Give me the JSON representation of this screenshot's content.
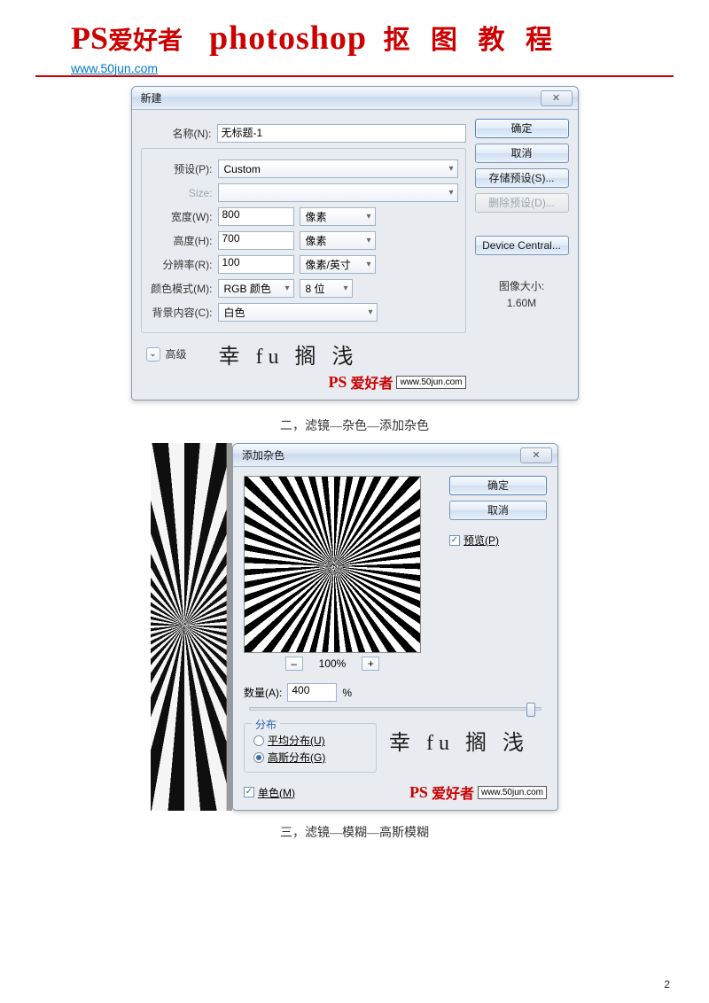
{
  "header": {
    "logo_ps": "PS",
    "logo_ah": "爱好者",
    "title_en": "photoshop",
    "title_cn": "抠 图 教 程",
    "url": "www.50jun.com"
  },
  "caption_noise": "二，滤镜—杂色—添加杂色",
  "caption_blur": "三，滤镜—模糊—高斯模糊",
  "page_number": "2",
  "dlg_new": {
    "title": "新建",
    "name_label": "名称(N):",
    "name_value": "无标题-1",
    "preset_label": "预设(P):",
    "preset_value": "Custom",
    "size_label": "Size:",
    "width_label": "宽度(W):",
    "width_value": "800",
    "width_unit": "像素",
    "height_label": "高度(H):",
    "height_value": "700",
    "height_unit": "像素",
    "res_label": "分辨率(R):",
    "res_value": "100",
    "res_unit": "像素/英寸",
    "mode_label": "颜色模式(M):",
    "mode_value": "RGB 颜色",
    "mode_bits": "8 位",
    "bg_label": "背景内容(C):",
    "bg_value": "白色",
    "advanced": "高级",
    "btn_ok": "确定",
    "btn_cancel": "取消",
    "btn_save_preset": "存储预设(S)...",
    "btn_del_preset": "删除预设(D)...",
    "btn_device": "Device Central...",
    "img_size_label": "图像大小:",
    "img_size_value": "1.60M",
    "watermark": "幸 fu 搁 浅",
    "wm_url": "www.50jun.com"
  },
  "dlg_noise": {
    "title": "添加杂色",
    "btn_ok": "确定",
    "btn_cancel": "取消",
    "preview_chk": "预览(P)",
    "zoom_value": "100%",
    "qty_label": "数量(A):",
    "qty_value": "400",
    "qty_unit": "%",
    "group_distro": "分布",
    "radio_uniform": "平均分布(U)",
    "radio_gaussian": "高斯分布(G)",
    "mono_chk": "单色(M)",
    "watermark": "幸 fu 搁 浅",
    "wm_url": "www.50jun.com"
  }
}
